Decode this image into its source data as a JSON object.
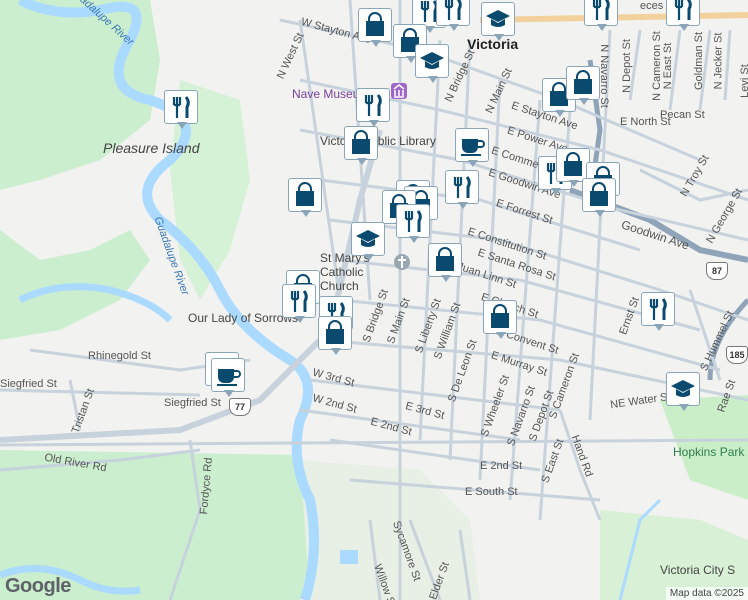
{
  "labels": {
    "victoria": "Victoria",
    "pleasure_island": "Pleasure Island",
    "guadalupe_river_1": "Guadalupe River",
    "guadalupe_river_2": "Guadalupe River",
    "nave_museum": "Nave Museum",
    "public_library": "Victoria Public Library",
    "st_marys": "St Mary's Catholic Church",
    "our_lady": "Our Lady of Sorrows",
    "hopkins_park": "Hopkins Park",
    "victoria_city": "Victoria City S",
    "w_stayton_ave": "W Stayton Ave",
    "e_stayton_ave": "E Stayton Ave",
    "e_power_ave": "E Power Ave",
    "e_commercial": "E Commercial",
    "e_goodwin_ave": "E Goodwin Ave",
    "goodwin_ave": "Goodwin Ave",
    "e_forrest_st": "E Forrest St",
    "e_constitution_st": "E Constitution St",
    "e_santa_rosa_st": "E Santa Rosa St",
    "e_juan_linn_st": "E Juan Linn St",
    "e_church_st": "E Church St",
    "e_convent_st": "E Convent St",
    "e_murray_st": "E Murray St",
    "e_north_st": "E North St",
    "pecan_st": "Pecan St",
    "ne_water_st": "NE Water St",
    "w_3rd_st": "W 3rd St",
    "w_2nd_st": "W 2nd St",
    "e_3rd_st": "E 3rd St",
    "e_2nd_st": "E 2nd St",
    "e_2nd_st_b": "E 2nd St",
    "e_south_st": "E South St",
    "rhinegold_st": "Rhinegold St",
    "siegfried_st": "Siegfried St",
    "siegfried_st_b": "Siegfried St",
    "tristan_st": "Tristan St",
    "old_river_rd": "Old River Rd",
    "fordyce_rd": "Fordyce Rd",
    "n_west_st": "N West St",
    "n_bridge_st": "N Bridge St",
    "n_main_st": "N Main St",
    "s_bridge_st": "S Bridge St",
    "s_main_st": "S Main St",
    "s_liberty_st": "S Liberty St",
    "s_william_st": "S William St",
    "s_de_leon_st": "S De Leon St",
    "s_wheeler_st": "S Wheeler St",
    "s_navarro_st": "S Navarro St",
    "s_depot_st": "S Depot St",
    "s_cameron_st": "S Cameron St",
    "s_east_st": "S East St",
    "hand_rd": "Hand Rd",
    "n_depot_st": "N Depot St",
    "n_cameron_st": "N Cameron St",
    "n_east_st": "N East St",
    "goldman_st": "Goldman St",
    "n_jecker_st": "N Jecker St",
    "levi_st": "Levi St",
    "n_navarro_st": "N Navarro St",
    "n_troy_st": "N Troy St",
    "n_george_st": "N George St",
    "s_hummel_st": "S Hummel St",
    "ernst_st": "Ernst St",
    "rae_st": "Rae St",
    "sycamore_st": "Sycamore St",
    "willow_st": "Willow St",
    "elder_st": "Elder St",
    "pieces_st": "eces St"
  },
  "shields": {
    "r87": "87",
    "r185": "185",
    "r77": "77"
  },
  "markers": [
    {
      "type": "shopping",
      "name": "shopping-marker"
    },
    {
      "type": "restaurant",
      "name": "restaurant-marker"
    },
    {
      "type": "school",
      "name": "school-marker"
    },
    {
      "type": "cafe",
      "name": "cafe-marker"
    }
  ],
  "attribution": {
    "google": "Google",
    "map_data": "Map data ©2025"
  },
  "colors": {
    "water": "#aadaff",
    "park": "#c6efc4",
    "road": "#ffffff",
    "marker": "#0b4a6f",
    "highway": "#8fa4b8"
  }
}
